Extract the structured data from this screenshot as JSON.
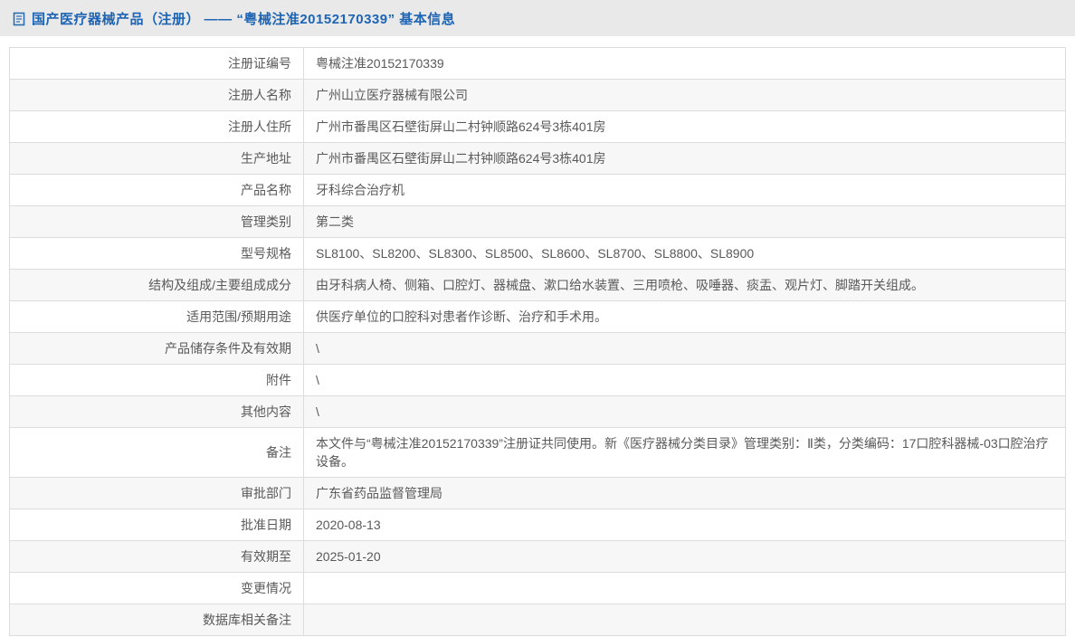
{
  "header": {
    "icon": "document-icon",
    "title": "国产医疗器械产品（注册） —— “粤械注准20152170339” 基本信息"
  },
  "colors": {
    "accent_blue": "#1e64b4",
    "page_background": "#ebebeb",
    "panel_background": "#ffffff",
    "alt_row_background": "#f7f7f7",
    "table_border": "#c6c6c6",
    "cell_border": "#dcdcdc",
    "text": "#595959"
  },
  "table": {
    "rows": [
      {
        "label": "注册证编号",
        "value": "粤械注准20152170339"
      },
      {
        "label": "注册人名称",
        "value": "广州山立医疗器械有限公司"
      },
      {
        "label": "注册人住所",
        "value": "广州市番禺区石壁街屏山二村钟顺路624号3栋401房"
      },
      {
        "label": "生产地址",
        "value": "广州市番禺区石壁街屏山二村钟顺路624号3栋401房"
      },
      {
        "label": "产品名称",
        "value": "牙科综合治疗机"
      },
      {
        "label": "管理类别",
        "value": "第二类"
      },
      {
        "label": "型号规格",
        "value": "SL8100、SL8200、SL8300、SL8500、SL8600、SL8700、SL8800、SL8900"
      },
      {
        "label": "结构及组成/主要组成成分",
        "value": "由牙科病人椅、侧箱、口腔灯、器械盘、漱口给水装置、三用喷枪、吸唾器、痰盂、观片灯、脚踏开关组成。"
      },
      {
        "label": "适用范围/预期用途",
        "value": "供医疗单位的口腔科对患者作诊断、治疗和手术用。"
      },
      {
        "label": "产品储存条件及有效期",
        "value": "\\"
      },
      {
        "label": "附件",
        "value": "\\"
      },
      {
        "label": "其他内容",
        "value": "\\"
      },
      {
        "label": "备注",
        "value": "本文件与“粤械注准20152170339”注册证共同使用。新《医疗器械分类目录》管理类别：Ⅱ类，分类编码：17口腔科器械-03口腔治疗设备。"
      },
      {
        "label": "审批部门",
        "value": "广东省药品监督管理局"
      },
      {
        "label": "批准日期",
        "value": "2020-08-13"
      },
      {
        "label": "有效期至",
        "value": "2025-01-20"
      },
      {
        "label": "变更情况",
        "value": ""
      },
      {
        "label": "数据库相关备注",
        "value": ""
      }
    ]
  }
}
